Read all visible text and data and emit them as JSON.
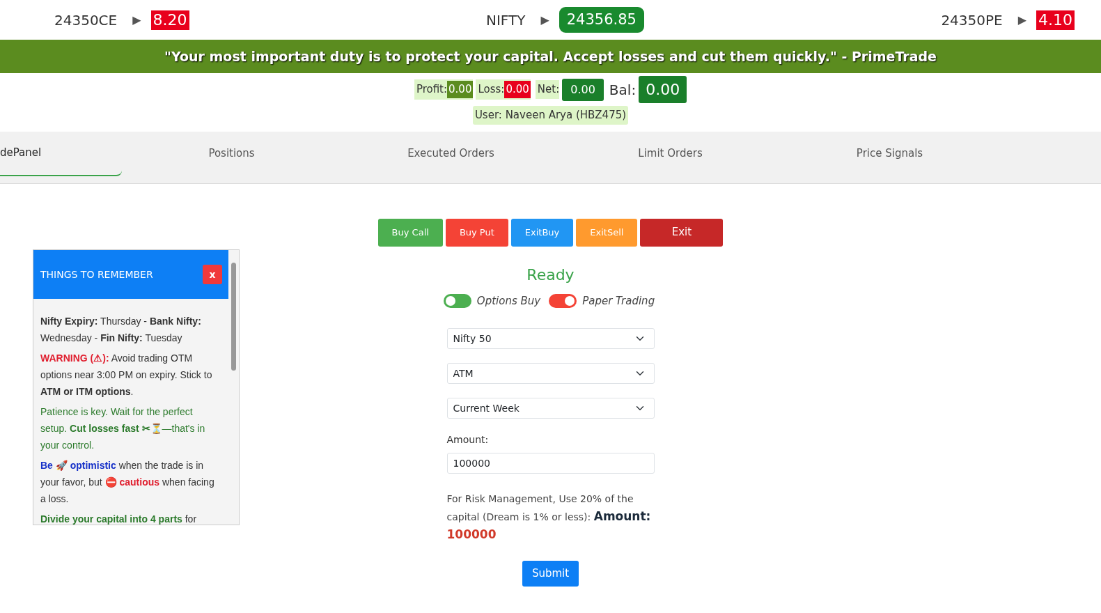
{
  "ticker": [
    {
      "kind": "small",
      "label": "24350CE",
      "arrow": "▶",
      "value": "8.20",
      "color": "#e8001c"
    },
    {
      "kind": "large",
      "label": "NIFTY",
      "arrow": "▶",
      "value": "24356.85",
      "color": "#198a2e"
    },
    {
      "kind": "small",
      "label": "24350PE",
      "arrow": "▶",
      "value": "4.10",
      "color": "#e8001c"
    }
  ],
  "quote": "\"Your most important duty is to protect your capital. Accept losses and cut them quickly.\" - PrimeTrade",
  "stats": [
    {
      "label": "Profit:",
      "value": "0.00",
      "color": "#5b8c1f",
      "kind": "small"
    },
    {
      "label": "Loss:",
      "value": "0.00",
      "color": "#e8001c",
      "kind": "small"
    },
    {
      "label": "Net:",
      "value": "0.00",
      "color": "#1a7f2a",
      "kind": "box"
    },
    {
      "label": "Bal:",
      "value": "0.00",
      "color": "#1a7f2a",
      "kind": "big"
    }
  ],
  "user": "User: Naveen Arya (HBZ475)",
  "tabs": [
    {
      "label": "dePanel",
      "selected": true
    },
    {
      "label": "Positions",
      "selected": false
    },
    {
      "label": "Executed Orders",
      "selected": false
    },
    {
      "label": "Limit Orders",
      "selected": false
    },
    {
      "label": "Price Signals",
      "selected": false
    }
  ],
  "notes": {
    "title": "THINGS TO REMEMBER",
    "close": "x",
    "paragraphs": [
      [
        {
          "kind": "bold",
          "text": "Nifty Expiry:"
        },
        {
          "kind": "plain",
          "text": " Thursday - "
        },
        {
          "kind": "bold",
          "text": "Bank Nifty:"
        },
        {
          "kind": "plain",
          "text": " Wednesday - "
        },
        {
          "kind": "bold",
          "text": "Fin Nifty:"
        },
        {
          "kind": "plain",
          "text": " Tuesday"
        }
      ],
      [
        {
          "kind": "danger",
          "text": "WARNING (⚠):"
        },
        {
          "kind": "plain",
          "text": " Avoid trading OTM options near 3:00 PM on expiry. Stick to "
        },
        {
          "kind": "bold",
          "text": "ATM or ITM options"
        },
        {
          "kind": "plain",
          "text": "."
        }
      ],
      [
        {
          "kind": "success",
          "text": "Patience is key. Wait for the perfect setup. "
        },
        {
          "kind": "successbold",
          "text": "Cut losses fast ✂⏳"
        },
        {
          "kind": "success",
          "text": "—that's in your control."
        }
      ],
      [
        {
          "kind": "info",
          "text": "Be 🚀 optimistic"
        },
        {
          "kind": "plain",
          "text": " when the trade is in your favor, but "
        },
        {
          "kind": "danger",
          "text": "⛔ cautious"
        },
        {
          "kind": "plain",
          "text": " when facing a loss."
        }
      ],
      [
        {
          "kind": "successbold",
          "text": "Divide your capital into 4 parts"
        },
        {
          "kind": "plain",
          "text": " for"
        }
      ]
    ]
  },
  "actions": [
    {
      "label": "Buy Call",
      "color": "#4caf50"
    },
    {
      "label": "Buy Put",
      "color": "#f44336"
    },
    {
      "label": "ExitBuy",
      "color": "#2196f3"
    },
    {
      "label": "ExitSell",
      "color": "#ff9a2e"
    },
    {
      "label": "Exit",
      "color": "#c62828"
    }
  ],
  "status": "Ready",
  "toggles": [
    {
      "label": "Options Buy",
      "on": false,
      "color": "#4caf50"
    },
    {
      "label": "Paper Trading",
      "on": true,
      "color": "#f44336"
    }
  ],
  "selects": [
    {
      "value": "Nifty 50"
    },
    {
      "value": "ATM"
    },
    {
      "value": "Current Week"
    }
  ],
  "amount": {
    "label": "Amount:",
    "value": "100000"
  },
  "risk": {
    "text": "For Risk Management, Use 20% of the capital (Dream is 1% or less): ",
    "label": "Amount:",
    "value": "100000"
  },
  "submit": "Submit"
}
